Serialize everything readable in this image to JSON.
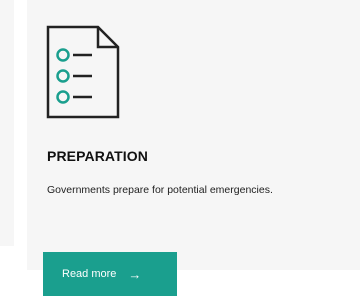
{
  "card": {
    "title": "PREPARATION",
    "description": "Governments prepare for potential emergencies.",
    "icon": "checklist-document-icon",
    "button": {
      "label": "Read more",
      "arrow": "→"
    }
  },
  "colors": {
    "accent": "#1a9f8e",
    "card_background": "#f6f6f6",
    "icon_stroke": "#222222",
    "title_text": "#111111"
  }
}
